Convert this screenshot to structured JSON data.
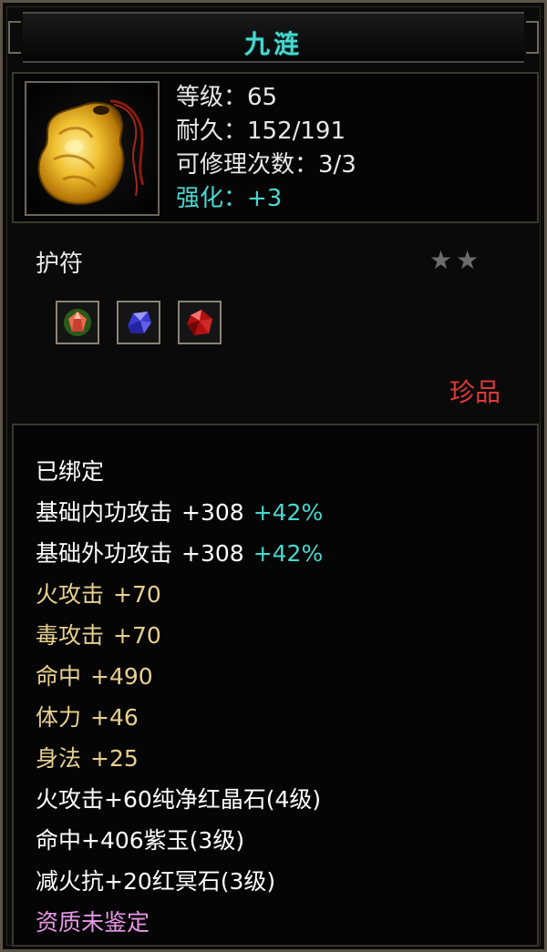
{
  "item": {
    "name": "九涟",
    "stats": {
      "level": "等级：65",
      "durability": "耐久：152/191",
      "repair": "可修理次数：3/3",
      "enhance": "强化：+3"
    },
    "type": "护符",
    "stars": 2,
    "rarity": "珍品",
    "attributes": [
      {
        "label": "已绑定",
        "value": "",
        "bonus": "",
        "color": "white"
      },
      {
        "label": "基础内功攻击",
        "value": "+308",
        "bonus": "+42%",
        "color": "white"
      },
      {
        "label": "基础外功攻击",
        "value": "+308",
        "bonus": "+42%",
        "color": "white"
      },
      {
        "label": "火攻击",
        "value": "+70",
        "bonus": "",
        "color": "gold"
      },
      {
        "label": "毒攻击",
        "value": "+70",
        "bonus": "",
        "color": "gold"
      },
      {
        "label": "命中",
        "value": "+490",
        "bonus": "",
        "color": "gold"
      },
      {
        "label": "体力",
        "value": "+46",
        "bonus": "",
        "color": "gold"
      },
      {
        "label": "身法",
        "value": "+25",
        "bonus": "",
        "color": "gold"
      },
      {
        "label": "火攻击+60纯净红晶石(4级)",
        "value": "",
        "bonus": "",
        "color": "white"
      },
      {
        "label": "命中+406紫玉(3级)",
        "value": "",
        "bonus": "",
        "color": "white"
      },
      {
        "label": "减火抗+20红冥石(3级)",
        "value": "",
        "bonus": "",
        "color": "white"
      },
      {
        "label": "资质未鉴定",
        "value": "",
        "bonus": "",
        "color": "pink"
      }
    ]
  },
  "icons": {
    "item_icon": "jade-amulet-icon",
    "gems": [
      "orange-gem-icon",
      "purple-gem-icon",
      "red-gem-icon"
    ],
    "star": "star-icon"
  },
  "colors": {
    "title": "#48d8d0",
    "cyan": "#48d8d0",
    "gold": "#e8d090",
    "rarity": "#e03838",
    "pink": "#e898e8"
  }
}
